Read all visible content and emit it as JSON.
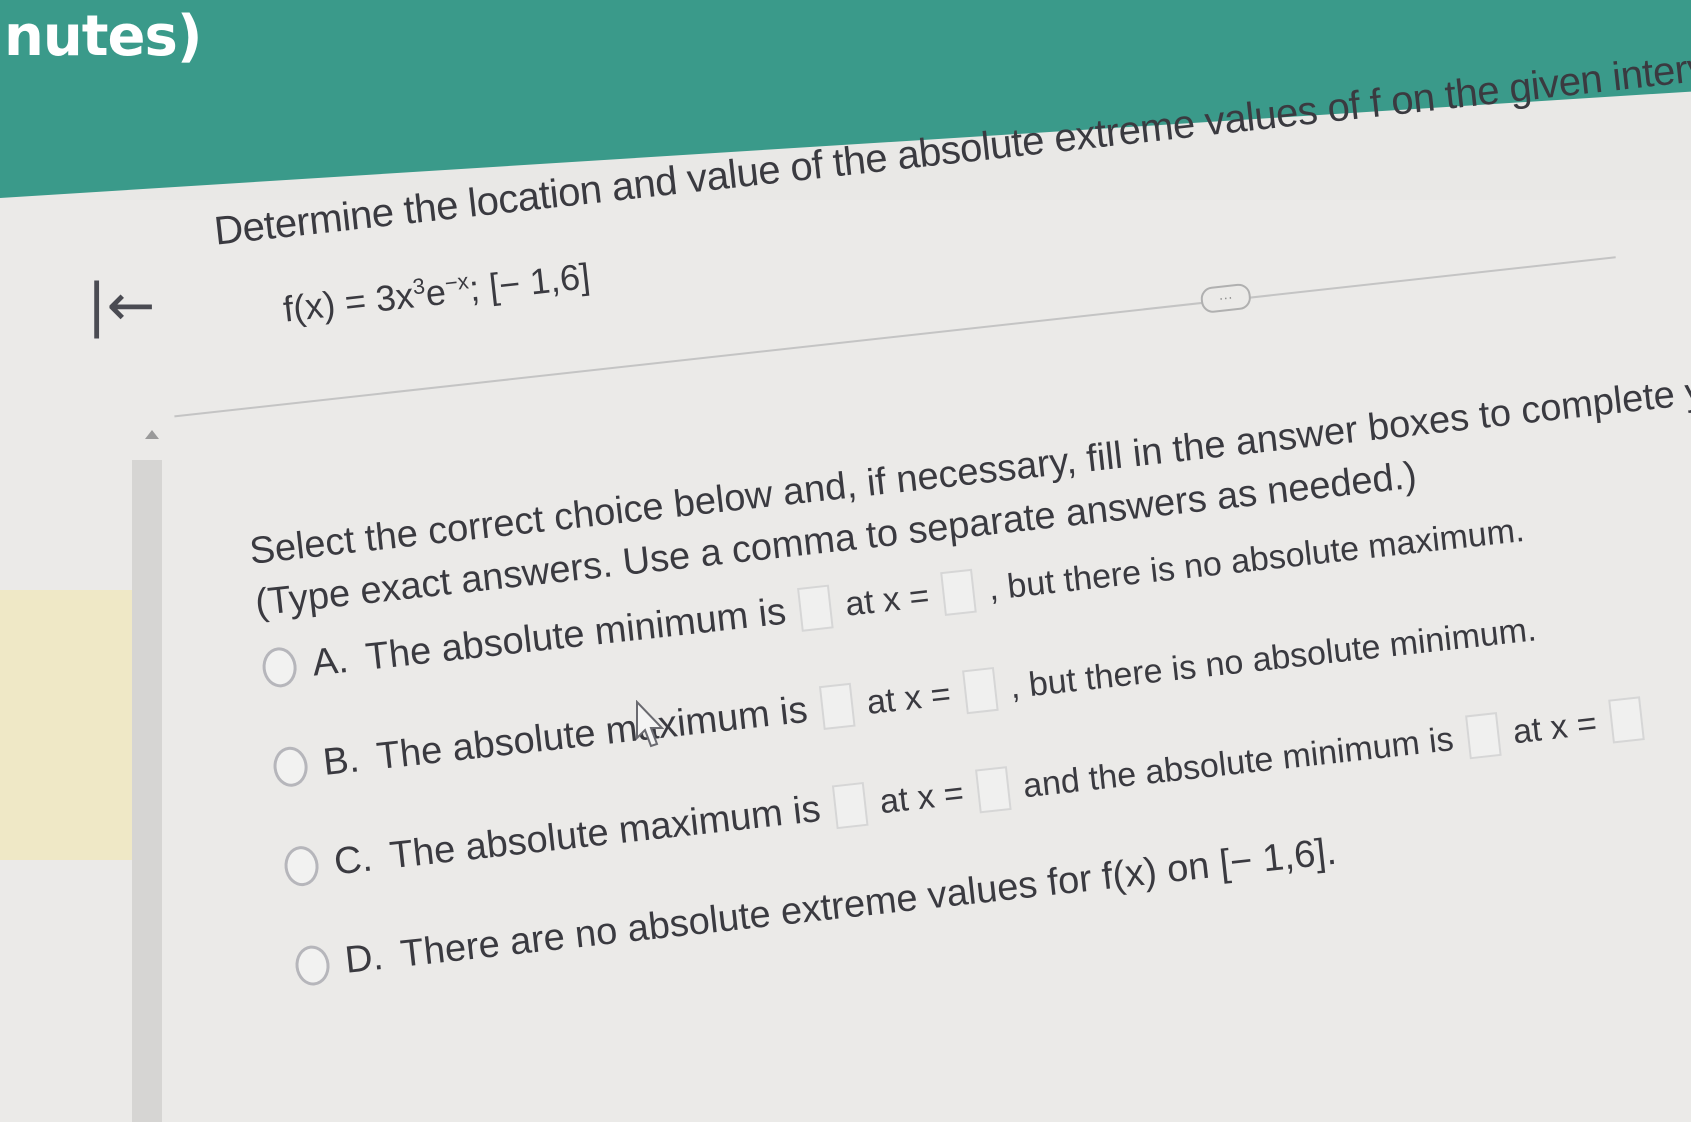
{
  "header": {
    "timer_text": "nutes)"
  },
  "question": {
    "prompt": "Determine the location and value of the absolute extreme values of f on the given interval, if they exist.",
    "function": {
      "lhs": "f(x) = 3x",
      "exp1": "3",
      "mid": "e",
      "exp2": "−x",
      "interval": "; [− 1,6]"
    },
    "more_label": "···"
  },
  "instruction": {
    "line1": "Select the correct choice below and, if necessary, fill in the answer boxes to complete your choice.",
    "line2": "(Type exact answers. Use a comma to separate answers as needed.)"
  },
  "choices": [
    {
      "letter": "A.",
      "text1": "The absolute minimum is",
      "text2": "at x =",
      "text3": ", but there is no absolute maximum."
    },
    {
      "letter": "B.",
      "text1": "The absolute maximum is",
      "text2": "at x =",
      "text3": ", but there is no absolute minimum."
    },
    {
      "letter": "C.",
      "text1": "The absolute maximum is",
      "text2": "at x =",
      "text3": "and the absolute minimum is",
      "text4": "at x ="
    },
    {
      "letter": "D.",
      "text1": "There are no absolute extreme values for f(x) on [− 1,6]."
    }
  ],
  "icons": {
    "back": "first-page-arrow-icon",
    "cursor": "mouse-pointer-icon"
  }
}
